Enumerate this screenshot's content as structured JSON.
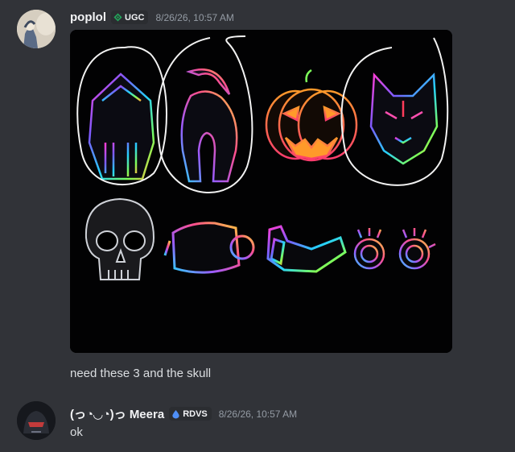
{
  "messages": [
    {
      "username": "poplol",
      "tag": {
        "icon": "ugc-gem-icon",
        "label": "UGC",
        "color": "#23a55a"
      },
      "timestamp": "8/26/26, 10:57 AM",
      "attachment": {
        "icons_row_1": [
          "knight-helmet-icon",
          "spartan-helmet-icon",
          "jack-o-lantern-icon",
          "fox-mask-icon"
        ],
        "icons_row_2": [
          "skull-icon",
          "visor-goggles-icon",
          "cyber-visor-icon",
          "spiked-goggles-icon"
        ],
        "circled": [
          "knight-helmet-icon",
          "spartan-helmet-icon",
          "fox-mask-icon"
        ]
      },
      "text": "need these 3 and the skull"
    },
    {
      "username": "(っ◔◡◔)っ Meera",
      "tag": {
        "icon": "rdvs-droplet-icon",
        "label": "RDVS",
        "color": "#3b82f6"
      },
      "timestamp": "8/26/26, 10:57 AM",
      "text": "ok"
    }
  ],
  "colors": {
    "background": "#313338",
    "username": "#f2f3f5",
    "timestamp": "#949ba4",
    "message_text": "#dbdee1"
  }
}
